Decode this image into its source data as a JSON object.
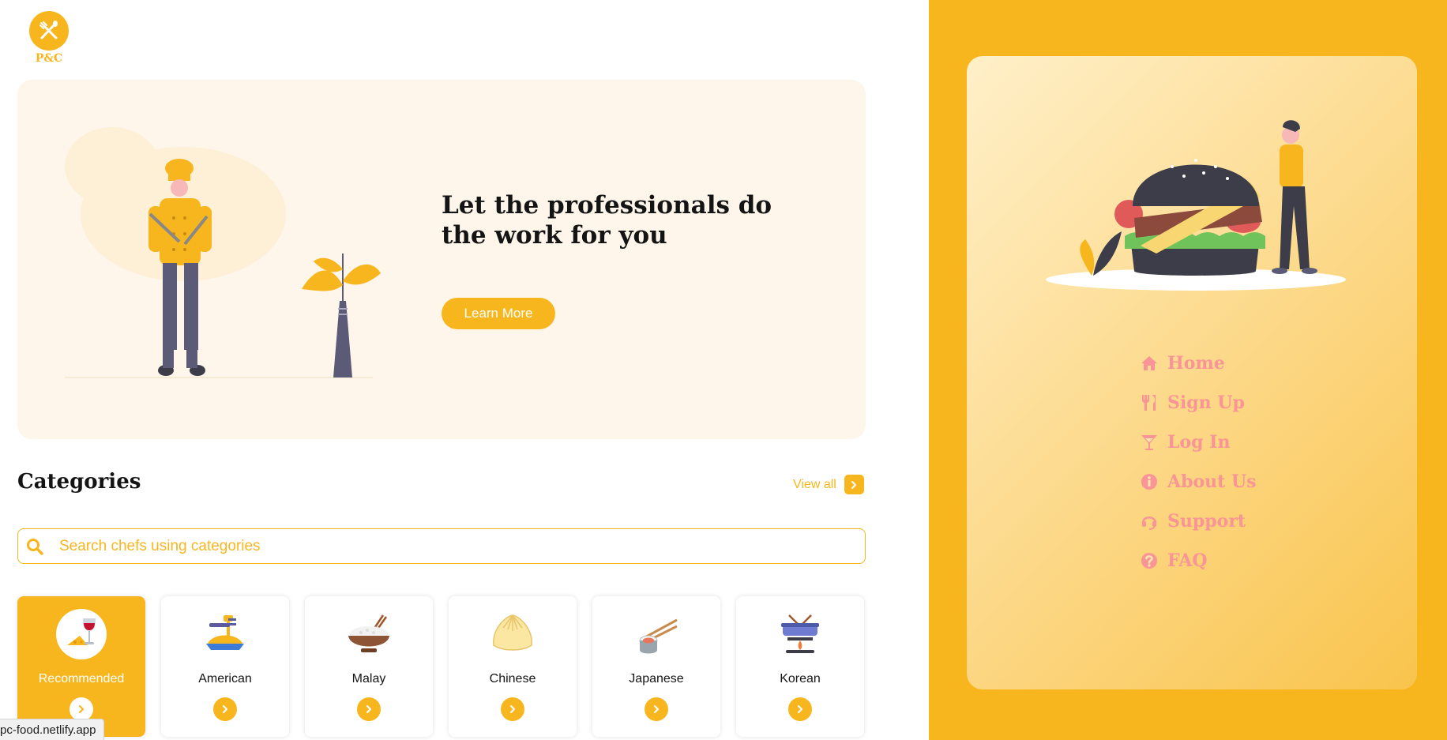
{
  "logo": {
    "text": "P&C"
  },
  "hero": {
    "title": "Let the professionals do the work for you",
    "button_label": "Learn More"
  },
  "categories": {
    "title": "Categories",
    "view_all_label": "View all",
    "search_placeholder": "Search chefs using categories",
    "items": [
      {
        "label": "Recommended",
        "icon": "wine-cheese-icon",
        "active": true
      },
      {
        "label": "American",
        "icon": "spaghetti-fork-icon",
        "active": false
      },
      {
        "label": "Malay",
        "icon": "rice-bowl-icon",
        "active": false
      },
      {
        "label": "Chinese",
        "icon": "dumpling-icon",
        "active": false
      },
      {
        "label": "Japanese",
        "icon": "sushi-chopsticks-icon",
        "active": false
      },
      {
        "label": "Korean",
        "icon": "hotpot-icon",
        "active": false
      }
    ]
  },
  "status_bar": {
    "url": "pc-food.netlify.app"
  },
  "nav": {
    "items": [
      {
        "label": "Home",
        "icon": "home-icon"
      },
      {
        "label": "Sign Up",
        "icon": "utensils-icon"
      },
      {
        "label": "Log In",
        "icon": "cocktail-icon"
      },
      {
        "label": "About Us",
        "icon": "info-icon"
      },
      {
        "label": "Support",
        "icon": "headset-icon"
      },
      {
        "label": "FAQ",
        "icon": "question-icon"
      }
    ]
  },
  "colors": {
    "accent": "#f8b61e",
    "hero_bg": "#fff6eb",
    "nav_text": "#f99596",
    "heading": "#141414"
  }
}
